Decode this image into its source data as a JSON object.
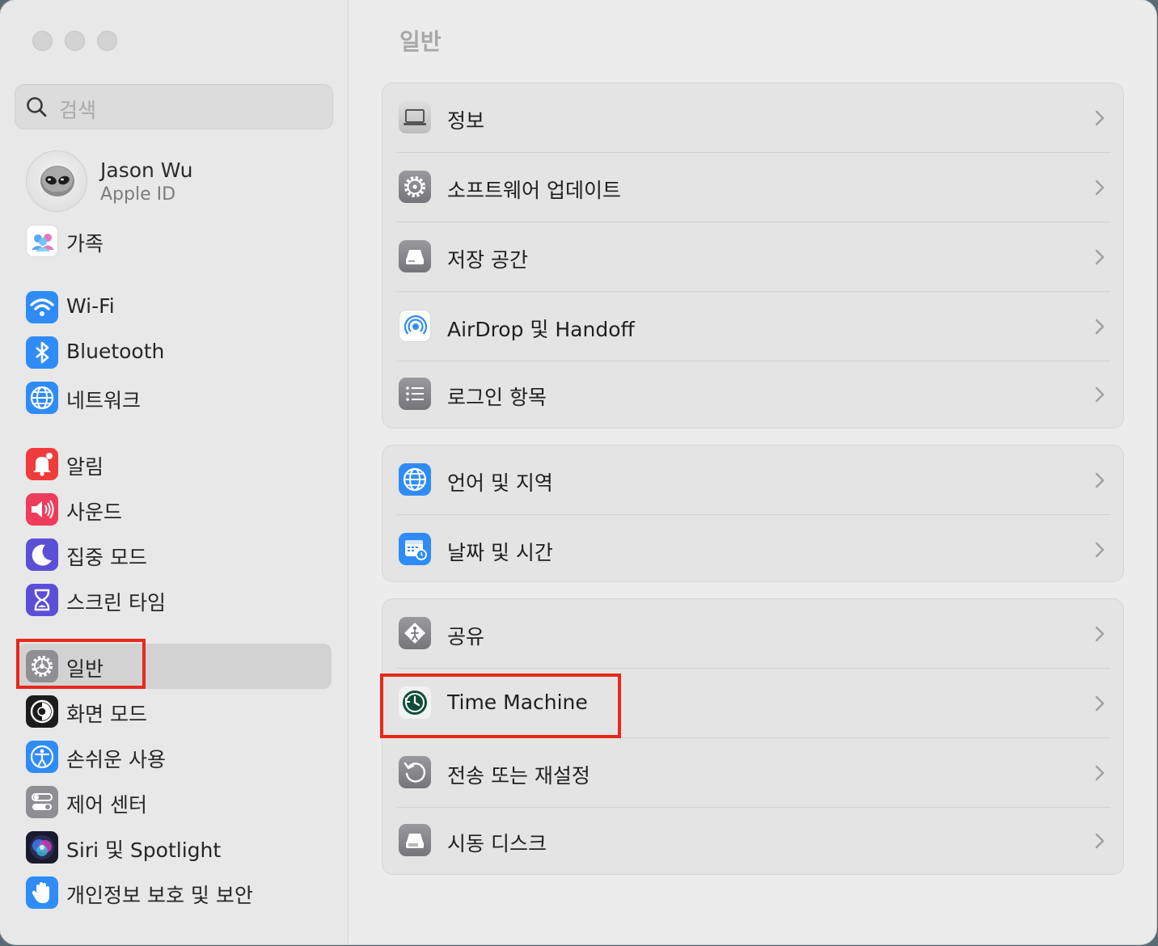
{
  "window": {
    "traffic_lights": [
      "close",
      "minimize",
      "zoom"
    ]
  },
  "sidebar": {
    "search": {
      "placeholder": "검색"
    },
    "profile": {
      "name": "Jason Wu",
      "subtitle": "Apple ID"
    },
    "items": [
      {
        "id": "family",
        "label": "가족",
        "icon": "family-icon",
        "color": "#ffffff"
      },
      {
        "id": "wifi",
        "label": "Wi-Fi",
        "icon": "wifi-icon",
        "color": "#2f8cf6"
      },
      {
        "id": "bluetooth",
        "label": "Bluetooth",
        "icon": "bluetooth-icon",
        "color": "#2f8cf6"
      },
      {
        "id": "network",
        "label": "네트워크",
        "icon": "globe-icon",
        "color": "#2f8cf6"
      },
      {
        "id": "notifications",
        "label": "알림",
        "icon": "bell-icon",
        "color": "#ef3b3b"
      },
      {
        "id": "sound",
        "label": "사운드",
        "icon": "speaker-icon",
        "color": "#ef3b5c"
      },
      {
        "id": "focus",
        "label": "집중 모드",
        "icon": "moon-icon",
        "color": "#5b4fd6"
      },
      {
        "id": "screen-time",
        "label": "스크린 타임",
        "icon": "hourglass-icon",
        "color": "#5b4fd6"
      },
      {
        "id": "general",
        "label": "일반",
        "icon": "gear-icon",
        "color": "#8e8e93",
        "selected": true
      },
      {
        "id": "appearance",
        "label": "화면 모드",
        "icon": "appearance-icon",
        "color": "#1c1c1c"
      },
      {
        "id": "accessibility",
        "label": "손쉬운 사용",
        "icon": "accessibility-icon",
        "color": "#2f8cf6"
      },
      {
        "id": "control-center",
        "label": "제어 센터",
        "icon": "toggles-icon",
        "color": "#8e8e93"
      },
      {
        "id": "siri",
        "label": "Siri 및 Spotlight",
        "icon": "siri-icon",
        "color": "#6b3ac8"
      },
      {
        "id": "privacy",
        "label": "개인정보 보호 및 보안",
        "icon": "hand-icon",
        "color": "#2f8cf6"
      }
    ]
  },
  "main": {
    "title": "일반",
    "groups": [
      {
        "rows": [
          {
            "label": "정보",
            "icon": "laptop-icon"
          },
          {
            "label": "소프트웨어 업데이트",
            "icon": "gear-badge-icon"
          },
          {
            "label": "저장 공간",
            "icon": "drive-icon"
          },
          {
            "label": "AirDrop 및 Handoff",
            "icon": "airdrop-icon"
          },
          {
            "label": "로그인 항목",
            "icon": "list-icon"
          }
        ]
      },
      {
        "rows": [
          {
            "label": "언어 및 지역",
            "icon": "globe-icon"
          },
          {
            "label": "날짜 및 시간",
            "icon": "calendar-clock-icon"
          }
        ]
      },
      {
        "rows": [
          {
            "label": "공유",
            "icon": "sharing-icon"
          },
          {
            "label": "Time Machine",
            "icon": "time-machine-icon",
            "highlighted": true
          },
          {
            "label": "전송 또는 재설정",
            "icon": "reset-icon"
          },
          {
            "label": "시동 디스크",
            "icon": "startup-disk-icon"
          }
        ]
      }
    ]
  },
  "annotations": {
    "highlight_color": "#e8281b"
  }
}
